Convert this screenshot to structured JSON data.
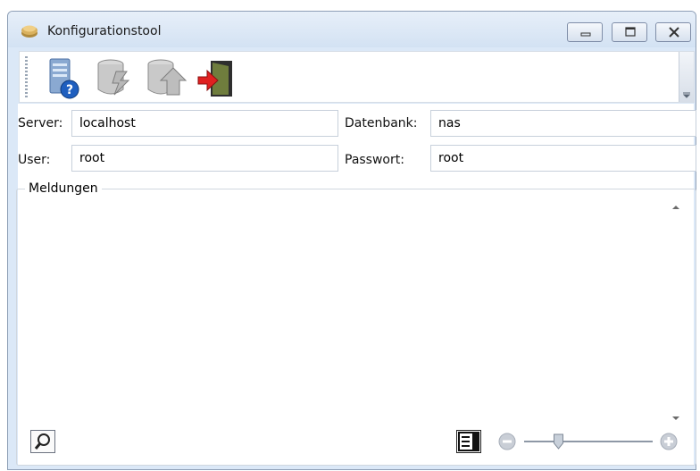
{
  "window": {
    "title": "Konfigurationstool"
  },
  "window_controls": {
    "minimize": "minimize-icon",
    "maximize": "maximize-icon",
    "close": "close-icon"
  },
  "toolbar": {
    "items": [
      "database-help-icon",
      "database-execute-icon",
      "database-upload-icon",
      "exit-icon"
    ]
  },
  "form": {
    "server": {
      "label": "Server:",
      "value": "localhost"
    },
    "database": {
      "label": "Datenbank:",
      "value": "nas"
    },
    "user": {
      "label": "User:",
      "value": "root"
    },
    "password": {
      "label": "Passwort:",
      "value": "root"
    }
  },
  "messages": {
    "title": "Meldungen"
  },
  "footer": {
    "zoom_level": 0.25
  }
}
